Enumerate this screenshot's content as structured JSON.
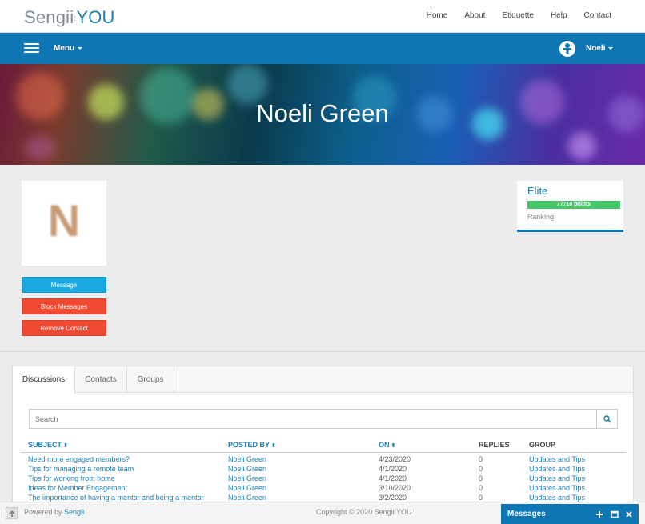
{
  "header": {
    "logo_part1": "Sengii",
    "logo_part2": "YOU",
    "nav": [
      "Home",
      "About",
      "Etiquette",
      "Help",
      "Contact"
    ]
  },
  "bluebar": {
    "menu_label": "Menu",
    "user_label": "Noeli"
  },
  "banner": {
    "name": "Noeli Green"
  },
  "profile": {
    "avatar_letter": "N",
    "buttons": {
      "message": "Message",
      "block": "Block Messages",
      "remove": "Remove Contact"
    },
    "rank": {
      "name": "Elite",
      "points_text": "77710 points",
      "progress_fraction": 1.0,
      "label": "Ranking"
    }
  },
  "tabs": [
    "Discussions",
    "Contacts",
    "Groups"
  ],
  "active_tab": "Discussions",
  "search": {
    "placeholder": "Search"
  },
  "table": {
    "headers": {
      "subject": "SUBJECT",
      "posted_by": "POSTED BY",
      "on": "ON",
      "replies": "REPLIES",
      "group": "GROUP"
    },
    "rows": [
      {
        "subject": "Need more engaged members?",
        "posted_by": "Noeli Green",
        "on": "4/23/2020",
        "replies": "0",
        "group": "Updates and Tips"
      },
      {
        "subject": "Tips for managing a remote team",
        "posted_by": "Noeli Green",
        "on": "4/1/2020",
        "replies": "0",
        "group": "Updates and Tips"
      },
      {
        "subject": "Tips for working from home",
        "posted_by": "Noeli Green",
        "on": "4/1/2020",
        "replies": "0",
        "group": "Updates and Tips"
      },
      {
        "subject": "Ideas for Member Engagement",
        "posted_by": "Noeli Green",
        "on": "3/10/2020",
        "replies": "0",
        "group": "Updates and Tips"
      },
      {
        "subject": "The importance of having a mentor and being a mentor",
        "posted_by": "Noeli Green",
        "on": "3/2/2020",
        "replies": "0",
        "group": "Updates and Tips"
      }
    ]
  },
  "footer": {
    "powered_prefix": "Powered by",
    "powered_link": "Sengii",
    "copyright": "Copyright © 2020 Sengii YOU"
  },
  "messages_bar": {
    "title": "Messages"
  },
  "colors": {
    "brand_blue": "#0e77b3",
    "message_button": "#19a9df",
    "danger_button": "#f04b32",
    "rank_fill": "#45c76a"
  }
}
